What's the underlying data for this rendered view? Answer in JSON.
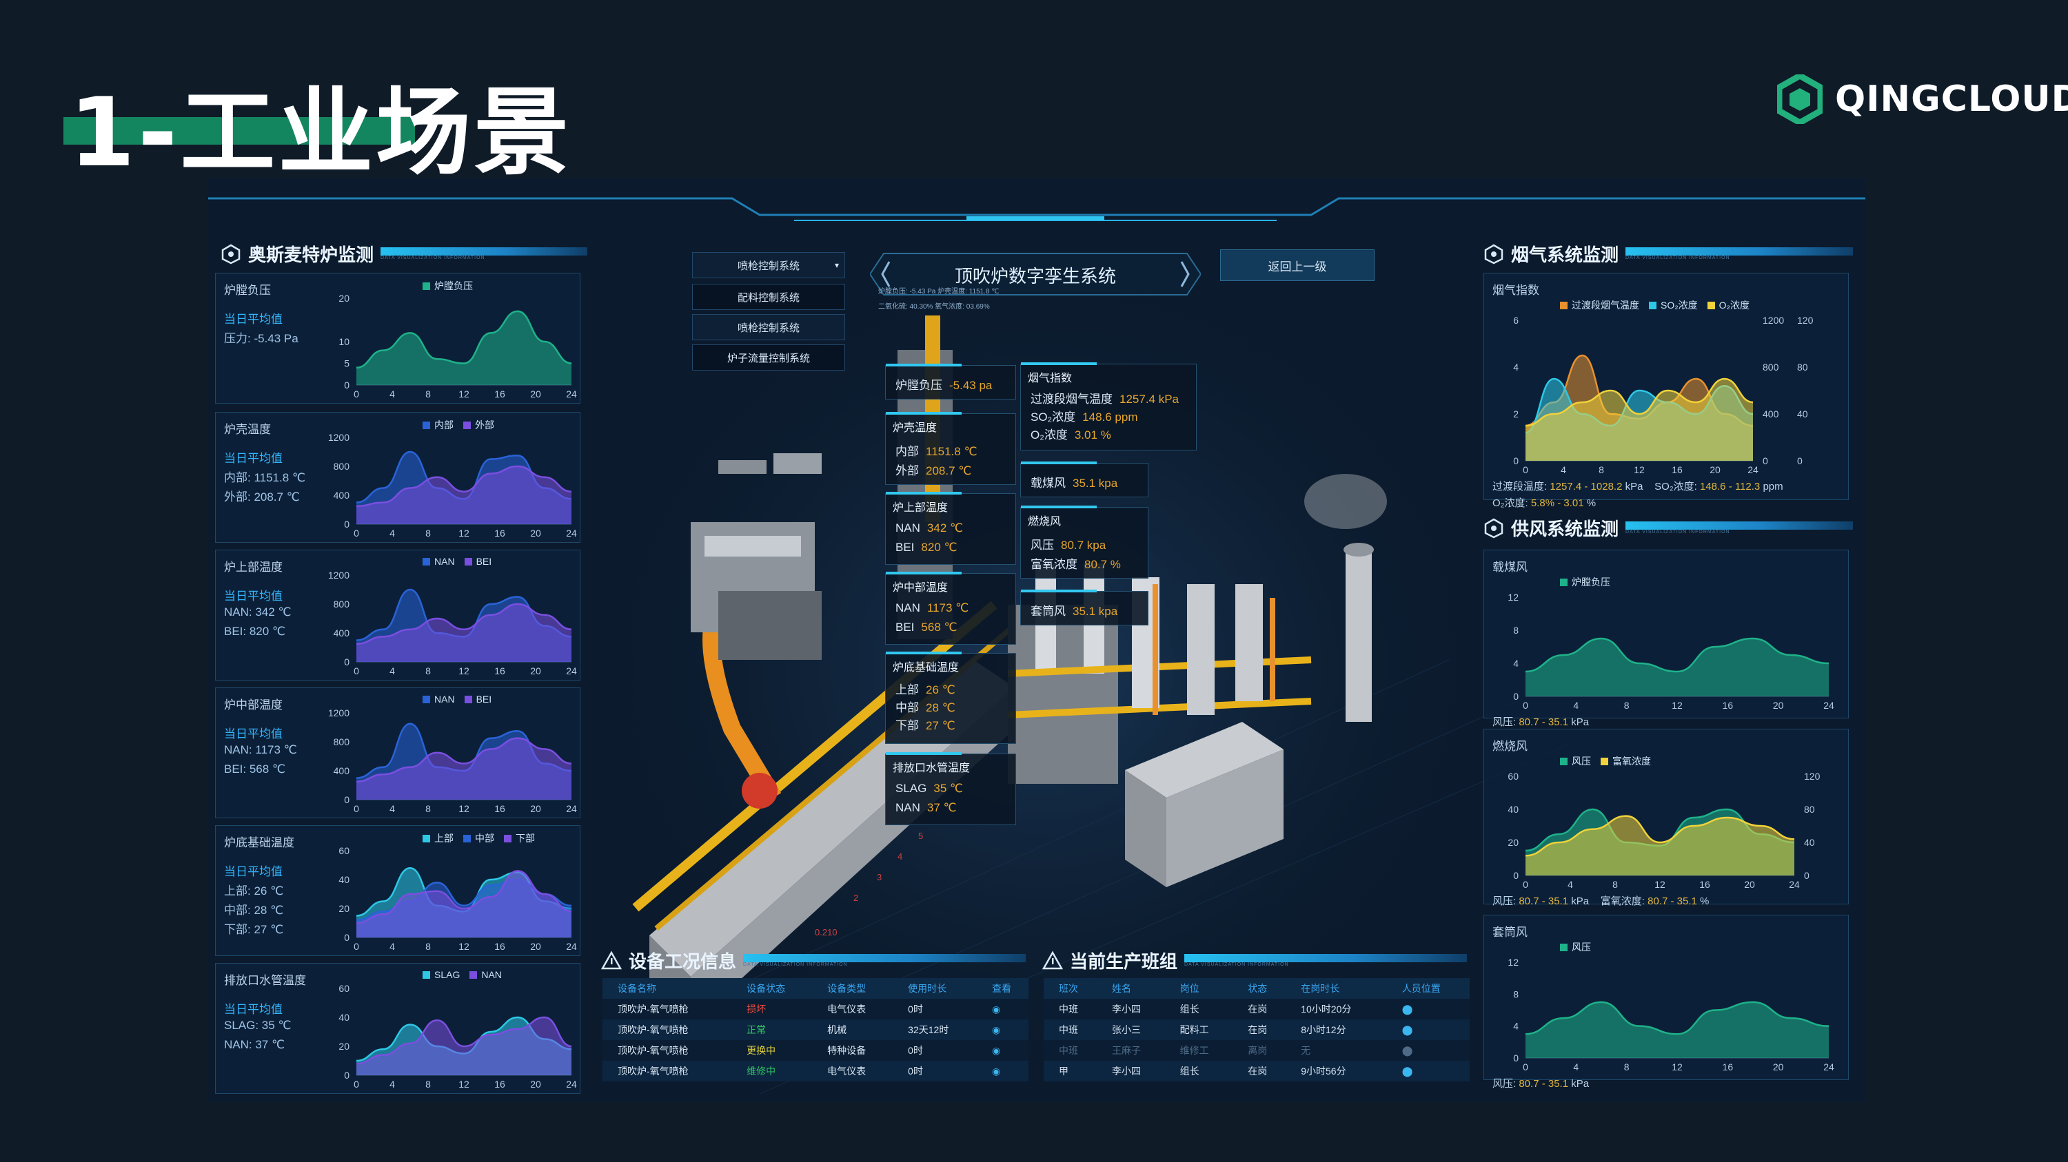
{
  "slide": {
    "title": "1-工业场景",
    "logo_text": "QINGCLOUD"
  },
  "colors": {
    "teal": "#1fb28a",
    "blue": "#2a63d8",
    "purple": "#7a4fe0",
    "cyan": "#2ec8e6",
    "orange": "#e8912e",
    "yellow": "#f0d23a"
  },
  "left_panel": {
    "title": "奥斯麦特炉监测",
    "sub": "DATA VISUALIZATION INFORMATION",
    "charts": [
      {
        "title": "炉膛负压",
        "avg": "当日平均值",
        "lines": [
          "压力: -5.43 Pa"
        ],
        "legend": [
          "炉膛负压"
        ]
      },
      {
        "title": "炉壳温度",
        "avg": "当日平均值",
        "lines": [
          "内部: 1151.8 ℃",
          "外部: 208.7 ℃"
        ],
        "legend": [
          "内部",
          "外部"
        ]
      },
      {
        "title": "炉上部温度",
        "avg": "当日平均值",
        "lines": [
          "NAN: 342 ℃",
          "BEI: 820 ℃"
        ],
        "legend": [
          "NAN",
          "BEI"
        ]
      },
      {
        "title": "炉中部温度",
        "avg": "当日平均值",
        "lines": [
          "NAN: 1173 ℃",
          "BEI: 568 ℃"
        ],
        "legend": [
          "NAN",
          "BEI"
        ]
      },
      {
        "title": "炉底基础温度",
        "avg": "当日平均值",
        "lines": [
          "上部: 26 ℃",
          "中部: 28 ℃",
          "下部: 27 ℃"
        ],
        "legend": [
          "上部",
          "中部",
          "下部"
        ]
      },
      {
        "title": "排放口水管温度",
        "avg": "当日平均值",
        "lines": [
          "SLAG: 35 ℃",
          "NAN: 37 ℃"
        ],
        "legend": [
          "SLAG",
          "NAN"
        ]
      }
    ]
  },
  "right_panel": {
    "title_flue": "烟气系统监测",
    "title_air": "供风系统监测",
    "sub": "DATA VISUALIZATION INFORMATION",
    "flue": {
      "title": "烟气指数",
      "legend": [
        "过渡段烟气温度",
        "SO₂浓度",
        "O₂浓度"
      ],
      "note1_label": "过渡段温度:",
      "note1_value": "1257.4 - 1028.2",
      "note1_unit": "kPa",
      "note2_label": "SO₂浓度:",
      "note2_value": "148.6 - 112.3",
      "note2_unit": "ppm",
      "note3_label": "O₂浓度:",
      "note3_value": "5.8% - 3.01",
      "note3_unit": "%"
    },
    "coal": {
      "title": "载煤风",
      "legend": [
        "炉膛负压"
      ],
      "note_label": "风压:",
      "note_value": "80.7 - 35.1",
      "note_unit": "kPa"
    },
    "burn": {
      "title": "燃烧风",
      "legend": [
        "风压",
        "富氧浓度"
      ],
      "note_label": "风压:",
      "note_value": "80.7 - 35.1",
      "note_unit": "kPa",
      "note2_label": "富氧浓度:",
      "note2_value": "80.7 - 35.1",
      "note2_unit": "%"
    },
    "sleeve": {
      "title": "套筒风",
      "legend": [
        "风压"
      ],
      "note_label": "风压:",
      "note_value": "80.7 - 35.1",
      "note_unit": "kPa"
    }
  },
  "center": {
    "title": "顶吹炉数字孪生系统",
    "back_button": "返回上一级",
    "control_menu": [
      "喷枪控制系统",
      "配料控制系统",
      "喷枪控制系统",
      "炉子流量控制系统"
    ],
    "mini_readout_1": "炉膛负压: -5.43 Pa  炉壳温度: 1151.8 ℃",
    "mini_readout_2": "二氧化硫: 40.30%  氧气浓度: 03.69%",
    "boxes": {
      "pressure": {
        "title": "炉膛负压",
        "value": "-5.43 pa"
      },
      "shell": {
        "title": "炉壳温度",
        "rows": [
          [
            "内部",
            "1151.8 ℃"
          ],
          [
            "外部",
            "208.7 ℃"
          ]
        ]
      },
      "upper": {
        "title": "炉上部温度",
        "rows": [
          [
            "NAN",
            "342 ℃"
          ],
          [
            "BEI",
            "820 ℃"
          ]
        ]
      },
      "middle": {
        "title": "炉中部温度",
        "rows": [
          [
            "NAN",
            "1173 ℃"
          ],
          [
            "BEI",
            "568 ℃"
          ]
        ]
      },
      "base": {
        "title": "炉底基础温度",
        "rows": [
          [
            "上部",
            "26 ℃"
          ],
          [
            "中部",
            "28 ℃"
          ],
          [
            "下部",
            "27 ℃"
          ]
        ]
      },
      "drain": {
        "title": "排放口水管温度",
        "rows": [
          [
            "SLAG",
            "35 ℃"
          ],
          [
            "NAN",
            "37 ℃"
          ]
        ]
      },
      "flue": {
        "title": "烟气指数",
        "rows": [
          [
            "过渡段烟气温度",
            "1257.4 kPa"
          ],
          [
            "SO₂浓度",
            "148.6 ppm"
          ],
          [
            "O₂浓度",
            "3.01 %"
          ]
        ]
      },
      "coal": {
        "title": "载煤风",
        "value": "35.1 kpa"
      },
      "burn": {
        "title": "燃烧风",
        "rows": [
          [
            "风压",
            "80.7 kpa"
          ],
          [
            "富氧浓度",
            "80.7 %"
          ]
        ]
      },
      "sleeve": {
        "title": "套筒风",
        "value": "35.1 kpa"
      }
    }
  },
  "equipment": {
    "title": "设备工况信息",
    "sub": "DATA VISUALIZATION INFORMATION",
    "headers": [
      "设备名称",
      "设备状态",
      "设备类型",
      "使用时长",
      "查看"
    ],
    "rows": [
      [
        "顶吹炉-氧气喷枪",
        "损坏",
        "电气仪表",
        "0时"
      ],
      [
        "顶吹炉-氧气喷枪",
        "正常",
        "机械",
        "32天12时"
      ],
      [
        "顶吹炉-氧气喷枪",
        "更换中",
        "特种设备",
        "0时"
      ],
      [
        "顶吹炉-氧气喷枪",
        "维修中",
        "电气仪表",
        "0时"
      ]
    ]
  },
  "shift": {
    "title": "当前生产班组",
    "sub": "DATA VISUALIZATION INFORMATION",
    "headers": [
      "班次",
      "姓名",
      "岗位",
      "状态",
      "在岗时长",
      "人员位置"
    ],
    "rows": [
      [
        "中班",
        "李小四",
        "组长",
        "在岗",
        "10小时20分"
      ],
      [
        "中班",
        "张小三",
        "配料工",
        "在岗",
        "8小时12分"
      ],
      [
        "中班",
        "王麻子",
        "维修工",
        "离岗",
        "无"
      ],
      [
        "甲",
        "李小四",
        "组长",
        "在岗",
        "9小时56分"
      ]
    ]
  },
  "chart_data": [
    {
      "type": "area",
      "title": "炉膛负压",
      "x": [
        0,
        4,
        8,
        12,
        16,
        20,
        24
      ],
      "ylim": [
        0,
        20
      ],
      "yticks": [
        0,
        5,
        10,
        20
      ],
      "series": [
        {
          "name": "炉膛负压",
          "values": [
            4,
            8,
            12,
            6,
            5,
            12,
            17,
            10,
            5
          ]
        }
      ]
    },
    {
      "type": "area",
      "title": "炉壳温度",
      "x": [
        0,
        4,
        8,
        12,
        16,
        20,
        24
      ],
      "ylim": [
        0,
        1200
      ],
      "yticks": [
        0,
        400,
        800,
        1200
      ],
      "series": [
        {
          "name": "内部",
          "values": [
            300,
            500,
            1000,
            500,
            350,
            900,
            950,
            500,
            350
          ]
        },
        {
          "name": "外部",
          "values": [
            250,
            300,
            500,
            650,
            450,
            700,
            800,
            650,
            450
          ]
        }
      ]
    },
    {
      "type": "area",
      "title": "炉上部温度",
      "x": [
        0,
        4,
        8,
        12,
        16,
        20,
        24
      ],
      "ylim": [
        0,
        1200
      ],
      "yticks": [
        0,
        400,
        800,
        1200
      ],
      "series": [
        {
          "name": "NAN",
          "values": [
            300,
            450,
            1000,
            400,
            350,
            800,
            900,
            500,
            350
          ]
        },
        {
          "name": "BEI",
          "values": [
            250,
            350,
            450,
            600,
            450,
            650,
            800,
            650,
            450
          ]
        }
      ]
    },
    {
      "type": "area",
      "title": "炉中部温度",
      "x": [
        0,
        4,
        8,
        12,
        16,
        20,
        24
      ],
      "ylim": [
        0,
        1200
      ],
      "yticks": [
        0,
        400,
        800,
        1200
      ],
      "series": [
        {
          "name": "NAN",
          "values": [
            300,
            450,
            1050,
            450,
            400,
            850,
            950,
            500,
            400
          ]
        },
        {
          "name": "BEI",
          "values": [
            250,
            350,
            450,
            650,
            500,
            700,
            850,
            700,
            500
          ]
        }
      ]
    },
    {
      "type": "area",
      "title": "炉底基础温度",
      "x": [
        0,
        4,
        8,
        12,
        16,
        20,
        24
      ],
      "ylim": [
        0,
        60
      ],
      "yticks": [
        0,
        20,
        40,
        60
      ],
      "series": [
        {
          "name": "上部",
          "values": [
            15,
            25,
            48,
            22,
            18,
            40,
            45,
            25,
            20
          ]
        },
        {
          "name": "中部",
          "values": [
            12,
            18,
            25,
            38,
            22,
            36,
            40,
            30,
            22
          ]
        },
        {
          "name": "下部",
          "values": [
            10,
            16,
            30,
            32,
            20,
            28,
            46,
            30,
            18
          ]
        }
      ]
    },
    {
      "type": "area",
      "title": "排放口水管温度",
      "x": [
        0,
        4,
        8,
        12,
        16,
        20,
        24
      ],
      "ylim": [
        0,
        60
      ],
      "yticks": [
        0,
        20,
        40,
        60
      ],
      "series": [
        {
          "name": "SLAG",
          "values": [
            10,
            18,
            35,
            20,
            15,
            30,
            40,
            25,
            18
          ]
        },
        {
          "name": "NAN",
          "values": [
            8,
            14,
            22,
            38,
            20,
            28,
            32,
            40,
            20
          ]
        }
      ]
    },
    {
      "type": "area",
      "title": "烟气指数",
      "x": [
        0,
        4,
        8,
        12,
        16,
        20,
        24
      ],
      "ylim": [
        0,
        6
      ],
      "yticks": [
        0,
        2,
        4,
        6
      ],
      "y2ticks": [
        0,
        400,
        800,
        1200
      ],
      "y3ticks": [
        0,
        40,
        80,
        120
      ],
      "series": [
        {
          "name": "过渡段烟气温度",
          "values": [
            1.5,
            2.5,
            4.5,
            2.0,
            1.8,
            2.5,
            3.5,
            2.0,
            1.5
          ]
        },
        {
          "name": "SO₂浓度",
          "values": [
            1.2,
            3.5,
            2.0,
            1.5,
            3.0,
            2.5,
            2.0,
            3.2,
            2.0
          ]
        },
        {
          "name": "O₂浓度",
          "values": [
            1.5,
            2.0,
            2.5,
            3.0,
            2.0,
            3.0,
            2.5,
            3.5,
            2.5
          ]
        }
      ]
    },
    {
      "type": "area",
      "title": "载煤风",
      "x": [
        0,
        4,
        8,
        12,
        16,
        20,
        24
      ],
      "ylim": [
        0,
        12
      ],
      "yticks": [
        0,
        4,
        8,
        12
      ],
      "series": [
        {
          "name": "炉膛负压",
          "values": [
            3,
            5,
            7,
            4,
            3,
            6,
            7,
            5,
            4
          ]
        }
      ]
    },
    {
      "type": "area",
      "title": "燃烧风",
      "x": [
        0,
        4,
        8,
        12,
        16,
        20,
        24
      ],
      "ylim": [
        0,
        60
      ],
      "yticks": [
        0,
        20,
        40,
        60
      ],
      "y2ticks": [
        0,
        40,
        80,
        120
      ],
      "series": [
        {
          "name": "风压",
          "values": [
            15,
            25,
            40,
            20,
            18,
            35,
            40,
            25,
            20
          ]
        },
        {
          "name": "富氧浓度",
          "values": [
            12,
            20,
            28,
            36,
            20,
            30,
            35,
            30,
            22
          ]
        }
      ]
    },
    {
      "type": "area",
      "title": "套筒风",
      "x": [
        0,
        4,
        8,
        12,
        16,
        20,
        24
      ],
      "ylim": [
        0,
        12
      ],
      "yticks": [
        0,
        4,
        8,
        12
      ],
      "series": [
        {
          "name": "风压",
          "values": [
            3,
            5,
            7,
            4,
            3,
            6,
            7,
            5,
            4
          ]
        }
      ]
    }
  ]
}
